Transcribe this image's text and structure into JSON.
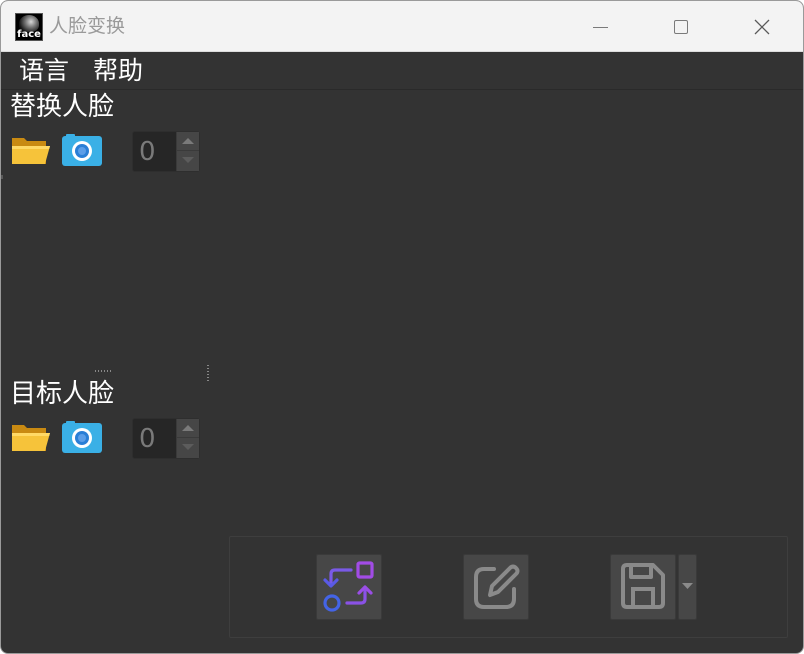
{
  "window": {
    "title": "人脸变换",
    "icon_text": "face",
    "icon": "face-app-icon"
  },
  "titlebar_controls": {
    "minimize_icon": "minimize-icon",
    "maximize_icon": "maximize-icon",
    "close_icon": "close-icon"
  },
  "menu": {
    "items": [
      {
        "label": "语言"
      },
      {
        "label": "帮助"
      }
    ]
  },
  "source_face": {
    "label": "替换人脸",
    "open_icon": "folder-open-icon",
    "camera_icon": "camera-icon",
    "spinner_value": "0"
  },
  "target_face": {
    "label": "目标人脸",
    "open_icon": "folder-open-icon",
    "camera_icon": "camera-icon",
    "spinner_value": "0"
  },
  "toolbar": {
    "swap_icon": "swap-icon",
    "edit_icon": "edit-icon",
    "save_icon": "save-icon",
    "dropdown_icon": "chevron-down-icon"
  },
  "colors": {
    "background": "#333333",
    "titlebar": "#f3f3f3",
    "folder": "#f2b92a",
    "camera": "#3ab0e6",
    "swap_purple": "#a24ce6",
    "swap_blue": "#4464e6"
  }
}
